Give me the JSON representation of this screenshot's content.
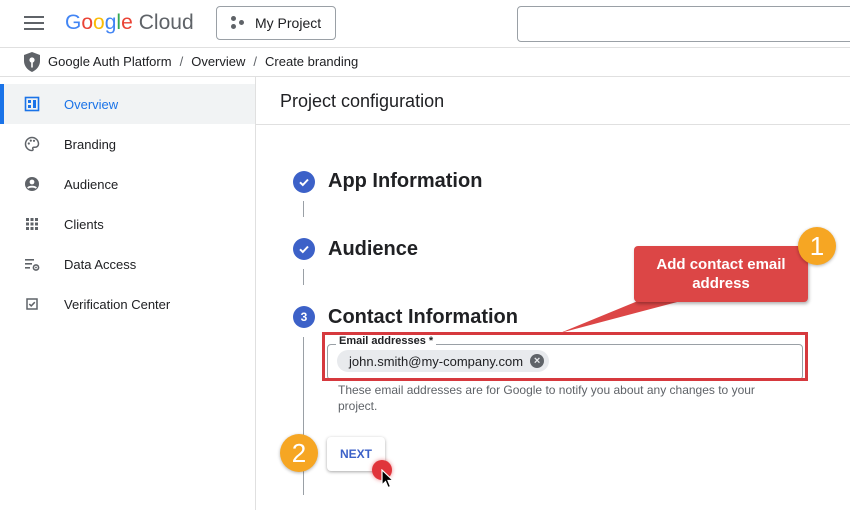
{
  "header": {
    "logo_google": "Google",
    "logo_cloud": "Cloud",
    "project_label": "My Project",
    "search_placeholder": ""
  },
  "breadcrumb": {
    "items": [
      "Google Auth Platform",
      "Overview",
      "Create branding"
    ],
    "separator": "/"
  },
  "sidebar": {
    "items": [
      {
        "label": "Overview",
        "icon": "dashboard-icon",
        "active": true
      },
      {
        "label": "Branding",
        "icon": "palette-icon",
        "active": false
      },
      {
        "label": "Audience",
        "icon": "person-icon",
        "active": false
      },
      {
        "label": "Clients",
        "icon": "grid-icon",
        "active": false
      },
      {
        "label": "Data Access",
        "icon": "data-settings-icon",
        "active": false
      },
      {
        "label": "Verification Center",
        "icon": "checkbox-icon",
        "active": false
      }
    ]
  },
  "main": {
    "title": "Project configuration",
    "steps": [
      {
        "title": "App Information",
        "status": "done"
      },
      {
        "title": "Audience",
        "status": "done"
      },
      {
        "title": "Contact Information",
        "status": "current",
        "number": "3"
      }
    ],
    "email_field": {
      "label": "Email addresses *",
      "chip_value": "john.smith@my-company.com",
      "helper_text": "These email addresses are for Google to notify you about any changes to your project."
    },
    "next_label": "NEXT"
  },
  "annotations": {
    "callout_text": "Add contact email address",
    "badge_1": "1",
    "badge_2": "2"
  },
  "colors": {
    "accent": "#1a73e8",
    "step_blue": "#3c61c8",
    "callout_red": "#dc4646",
    "badge_orange": "#f6a623"
  }
}
